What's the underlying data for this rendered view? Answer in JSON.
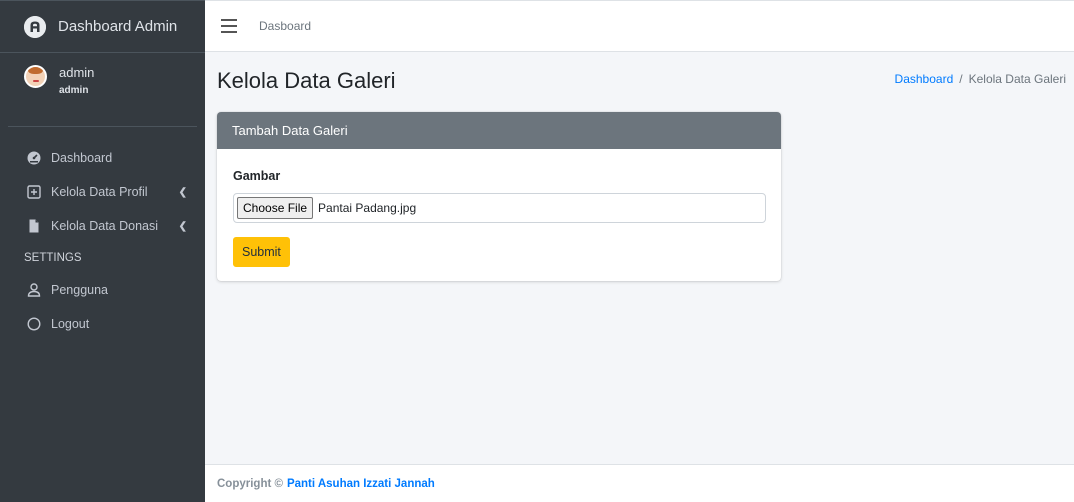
{
  "brand": {
    "title": "Dashboard Admin",
    "logo_icon": "circle-a-logo-icon"
  },
  "user": {
    "name": "admin",
    "role": "admin"
  },
  "nav": {
    "dashboard": "Dashboard",
    "profil": "Kelola Data Profil",
    "donasi": "Kelola Data Donasi",
    "settings_header": "SETTINGS",
    "pengguna": "Pengguna",
    "logout": "Logout"
  },
  "topbar": {
    "link": "Dasboard"
  },
  "page": {
    "title": "Kelola Data Galeri"
  },
  "breadcrumb": {
    "home": "Dashboard",
    "separator": "/",
    "current": "Kelola Data Galeri"
  },
  "card": {
    "header": "Tambah Data Galeri",
    "field_label": "Gambar",
    "file_button": "Choose File",
    "file_name": "Pantai Padang.jpg",
    "submit": "Submit"
  },
  "footer": {
    "prefix": "Copyright ©",
    "org": "Panti Asuhan Izzati Jannah"
  },
  "colors": {
    "sidebar": "#343a40",
    "accent": "#007bff",
    "submit": "#ffc107",
    "card_header": "#6c757d",
    "content_bg": "#f4f6f9"
  }
}
